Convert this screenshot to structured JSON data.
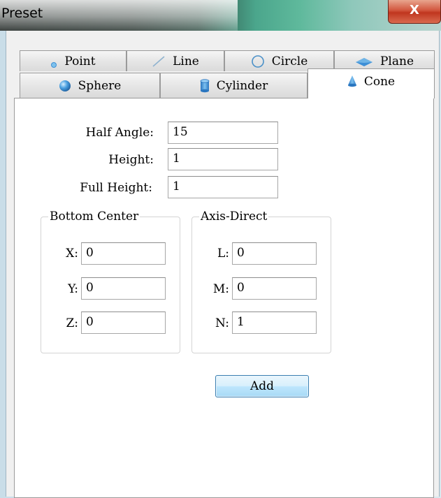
{
  "window": {
    "title": "Preset",
    "close_glyph": "X"
  },
  "tabs": {
    "row1": [
      {
        "label": "Point",
        "icon": "point-icon"
      },
      {
        "label": "Line",
        "icon": "line-icon"
      },
      {
        "label": "Circle",
        "icon": "circle-icon"
      },
      {
        "label": "Plane",
        "icon": "plane-icon"
      }
    ],
    "row2": [
      {
        "label": "Sphere",
        "icon": "sphere-icon"
      },
      {
        "label": "Cylinder",
        "icon": "cylinder-icon"
      },
      {
        "label": "Cone",
        "icon": "cone-icon",
        "active": true
      }
    ]
  },
  "form": {
    "half_angle": {
      "label": "Half Angle:",
      "value": "15"
    },
    "height": {
      "label": "Height:",
      "value": "1"
    },
    "full_height": {
      "label": "Full Height:",
      "value": "1"
    },
    "bottom_center": {
      "legend": "Bottom Center",
      "x": {
        "label": "X:",
        "value": "0"
      },
      "y": {
        "label": "Y:",
        "value": "0"
      },
      "z": {
        "label": "Z:",
        "value": "0"
      }
    },
    "axis_direct": {
      "legend": "Axis-Direct",
      "l": {
        "label": "L:",
        "value": "0"
      },
      "m": {
        "label": "M:",
        "value": "0"
      },
      "n": {
        "label": "N:",
        "value": "1"
      }
    },
    "add_label": "Add"
  },
  "colors": {
    "icon_blue": "#3d8fd6",
    "panel_bg": "#ffffff",
    "window_bg": "#f0f0f0",
    "button_border": "#3c7fb1",
    "close_red": "#c0361f"
  }
}
